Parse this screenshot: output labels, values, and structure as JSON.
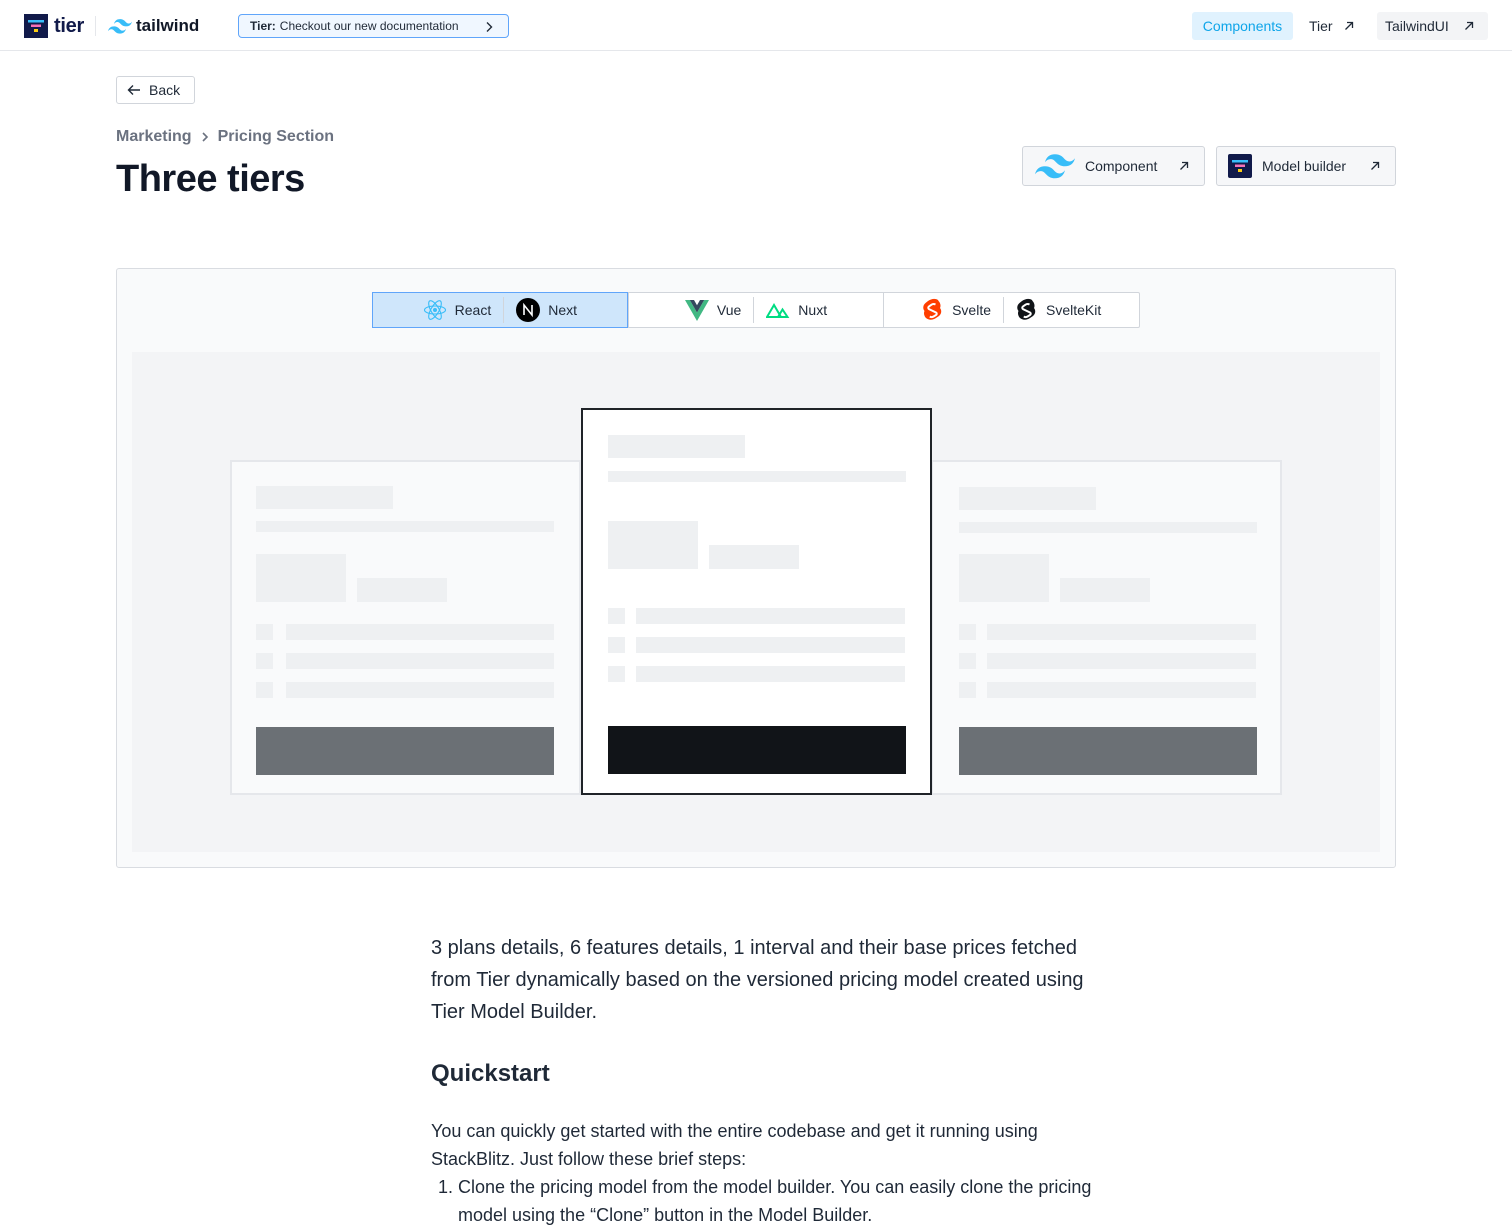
{
  "nav": {
    "tier_logo": "tier",
    "tailwind_logo": "tailwind",
    "announcement": {
      "prefix": "Tier:",
      "text": "Checkout our new documentation"
    },
    "links": [
      {
        "label": "Components",
        "active": true
      },
      {
        "label": "Tier",
        "external": true
      },
      {
        "label": "TailwindUI",
        "external": true
      }
    ]
  },
  "header": {
    "back_label": "Back",
    "breadcrumb": [
      "Marketing",
      "Pricing Section"
    ],
    "title": "Three tiers",
    "component_button": "Component",
    "model_builder_button": "Model builder"
  },
  "frameworks": {
    "groups": [
      {
        "active": true,
        "items": [
          {
            "label": "React",
            "icon": "react-icon"
          },
          {
            "label": "Next",
            "icon": "nextjs-icon"
          }
        ]
      },
      {
        "active": false,
        "items": [
          {
            "label": "Vue",
            "icon": "vue-icon"
          },
          {
            "label": "Nuxt",
            "icon": "nuxt-icon"
          }
        ]
      },
      {
        "active": false,
        "items": [
          {
            "label": "Svelte",
            "icon": "svelte-icon"
          },
          {
            "label": "SvelteKit",
            "icon": "sveltekit-icon"
          }
        ]
      }
    ]
  },
  "content": {
    "description": "3 plans details, 6 features details, 1 interval and their base prices fetched from Tier dynamically based on the versioned pricing model created using Tier Model Builder.",
    "quickstart_heading": "Quickstart",
    "quickstart_text": "You can quickly get started with the entire codebase and get it running using StackBlitz. Just follow these brief steps:",
    "steps": [
      "1. Clone the pricing model from the model builder. You can easily clone the pricing model using the “Clone” button in the Model Builder."
    ]
  },
  "colors": {
    "accent": "#0ea5e9",
    "brand_navy": "#111a4a",
    "active_tab_bg": "#cfe6fb",
    "active_tab_border": "#60a5fa"
  }
}
